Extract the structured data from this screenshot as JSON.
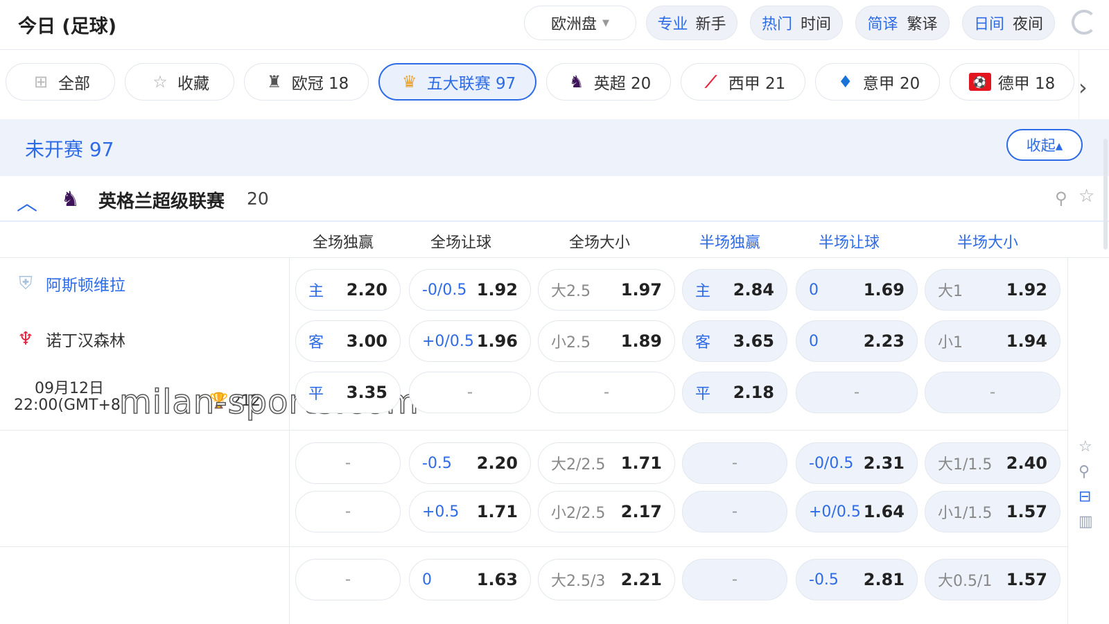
{
  "header": {
    "title": "今日 (足球)",
    "odds_type": "欧洲盘",
    "toggles": [
      {
        "on": "专业",
        "off": "新手"
      },
      {
        "on": "热门",
        "off": "时间"
      },
      {
        "on": "简译",
        "off": "繁译"
      },
      {
        "on": "日间",
        "off": "夜间"
      }
    ]
  },
  "chips": [
    {
      "label": "全部",
      "icon": "grid-icon"
    },
    {
      "label": "收藏",
      "icon": "star-icon"
    },
    {
      "label": "欧冠 18",
      "icon": "ucl-trophy-icon"
    },
    {
      "label": "五大联赛 97",
      "icon": "top5-leagues-icon"
    },
    {
      "label": "英超 20",
      "icon": "premier-league-lion-icon"
    },
    {
      "label": "西甲 21",
      "icon": "laliga-icon"
    },
    {
      "label": "意甲 20",
      "icon": "serie-a-icon"
    },
    {
      "label": "德甲 18",
      "icon": "bundesliga-icon"
    }
  ],
  "section": {
    "title": "未开赛 97",
    "collapse": "收起▴"
  },
  "league": {
    "name": "英格兰超级联赛",
    "count": "20"
  },
  "columns": [
    "全场独赢",
    "全场让球",
    "全场大小",
    "半场独赢",
    "半场让球",
    "半场大小"
  ],
  "match": {
    "home": "阿斯顿维拉",
    "away": "诺丁汉森林",
    "date": "09月12日",
    "time": "22:00(GMT+8",
    "corner": "212",
    "watermark": "milan-sports.com"
  },
  "odds_rows": [
    [
      {
        "lbl": "主",
        "val": "2.20"
      },
      {
        "lbl": "-0/0.5",
        "val": "1.92"
      },
      {
        "lbl": "大2.5",
        "val": "1.97",
        "grey": true
      },
      {
        "lbl": "主",
        "val": "2.84"
      },
      {
        "lbl": "0",
        "val": "1.69"
      },
      {
        "lbl": "大1",
        "val": "1.92",
        "grey": true
      }
    ],
    [
      {
        "lbl": "客",
        "val": "3.00"
      },
      {
        "lbl": "+0/0.5",
        "val": "1.96"
      },
      {
        "lbl": "小2.5",
        "val": "1.89",
        "grey": true
      },
      {
        "lbl": "客",
        "val": "3.65"
      },
      {
        "lbl": "0",
        "val": "2.23"
      },
      {
        "lbl": "小1",
        "val": "1.94",
        "grey": true
      }
    ],
    [
      {
        "lbl": "平",
        "val": "3.35"
      },
      {
        "empty": "-"
      },
      {
        "empty": "-"
      },
      {
        "lbl": "平",
        "val": "2.18"
      },
      {
        "empty": "-"
      },
      {
        "empty": "-"
      }
    ],
    [
      {
        "empty": "-"
      },
      {
        "lbl": "-0.5",
        "val": "2.20"
      },
      {
        "lbl": "大2/2.5",
        "val": "1.71",
        "grey": true
      },
      {
        "empty": "-"
      },
      {
        "lbl": "-0/0.5",
        "val": "2.31"
      },
      {
        "lbl": "大1/1.5",
        "val": "2.40",
        "grey": true
      }
    ],
    [
      {
        "empty": "-"
      },
      {
        "lbl": "+0.5",
        "val": "1.71"
      },
      {
        "lbl": "小2/2.5",
        "val": "2.17",
        "grey": true
      },
      {
        "empty": "-"
      },
      {
        "lbl": "+0/0.5",
        "val": "1.64"
      },
      {
        "lbl": "小1/1.5",
        "val": "1.57",
        "grey": true
      }
    ],
    [
      {
        "empty": "-"
      },
      {
        "lbl": "0",
        "val": "1.63"
      },
      {
        "lbl": "大2.5/3",
        "val": "2.21",
        "grey": true
      },
      {
        "empty": "-"
      },
      {
        "lbl": "-0.5",
        "val": "2.81"
      },
      {
        "lbl": "大0.5/1",
        "val": "1.57",
        "grey": true
      }
    ]
  ],
  "colors": {
    "accent": "#2e6be6",
    "tint": "#eef3fb",
    "border": "#e3e7ee"
  }
}
